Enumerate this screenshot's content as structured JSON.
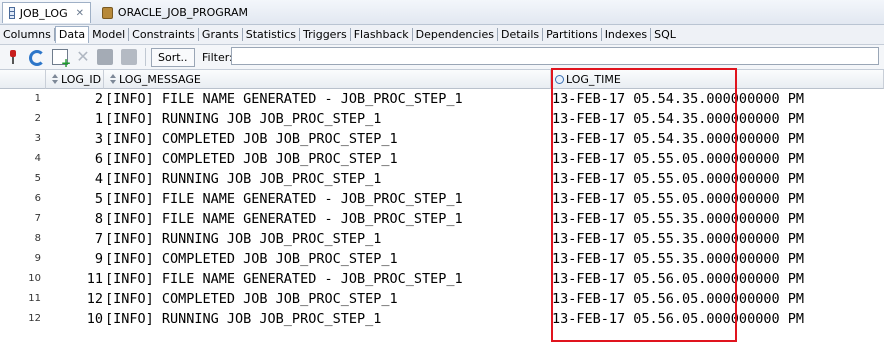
{
  "doc_tabs": [
    {
      "label": "JOB_LOG",
      "icon": "table-grid-icon"
    },
    {
      "label": "ORACLE_JOB_PROGRAM",
      "icon": "program-icon"
    }
  ],
  "sub_tabs": [
    "Columns",
    "Data",
    "Model",
    "Constraints",
    "Grants",
    "Statistics",
    "Triggers",
    "Flashback",
    "Dependencies",
    "Details",
    "Partitions",
    "Indexes",
    "SQL"
  ],
  "toolbar": {
    "sort_label": "Sort..",
    "filter_label": "Filter:",
    "filter_value": ""
  },
  "columns": {
    "id": "LOG_ID",
    "message": "LOG_MESSAGE",
    "time": "LOG_TIME"
  },
  "rows": [
    {
      "n": "1",
      "id": "2",
      "msg": "[INFO] FILE NAME GENERATED - JOB_PROC_STEP_1",
      "time": "13-FEB-17 05.54.35.000000000 PM"
    },
    {
      "n": "2",
      "id": "1",
      "msg": "[INFO] RUNNING JOB JOB_PROC_STEP_1",
      "time": "13-FEB-17 05.54.35.000000000 PM"
    },
    {
      "n": "3",
      "id": "3",
      "msg": "[INFO] COMPLETED JOB JOB_PROC_STEP_1",
      "time": "13-FEB-17 05.54.35.000000000 PM"
    },
    {
      "n": "4",
      "id": "6",
      "msg": "[INFO] COMPLETED JOB JOB_PROC_STEP_1",
      "time": "13-FEB-17 05.55.05.000000000 PM"
    },
    {
      "n": "5",
      "id": "4",
      "msg": "[INFO] RUNNING JOB JOB_PROC_STEP_1",
      "time": "13-FEB-17 05.55.05.000000000 PM"
    },
    {
      "n": "6",
      "id": "5",
      "msg": "[INFO] FILE NAME GENERATED - JOB_PROC_STEP_1",
      "time": "13-FEB-17 05.55.05.000000000 PM"
    },
    {
      "n": "7",
      "id": "8",
      "msg": "[INFO] FILE NAME GENERATED - JOB_PROC_STEP_1",
      "time": "13-FEB-17 05.55.35.000000000 PM"
    },
    {
      "n": "8",
      "id": "7",
      "msg": "[INFO] RUNNING JOB JOB_PROC_STEP_1",
      "time": "13-FEB-17 05.55.35.000000000 PM"
    },
    {
      "n": "9",
      "id": "9",
      "msg": "[INFO] COMPLETED JOB JOB_PROC_STEP_1",
      "time": "13-FEB-17 05.55.35.000000000 PM"
    },
    {
      "n": "10",
      "id": "11",
      "msg": "[INFO] FILE NAME GENERATED - JOB_PROC_STEP_1",
      "time": "13-FEB-17 05.56.05.000000000 PM"
    },
    {
      "n": "11",
      "id": "12",
      "msg": "[INFO] COMPLETED JOB JOB_PROC_STEP_1",
      "time": "13-FEB-17 05.56.05.000000000 PM"
    },
    {
      "n": "12",
      "id": "10",
      "msg": "[INFO] RUNNING JOB JOB_PROC_STEP_1",
      "time": "13-FEB-17 05.56.05.000000000 PM"
    }
  ],
  "colors": {
    "highlight": "#e0141e"
  }
}
